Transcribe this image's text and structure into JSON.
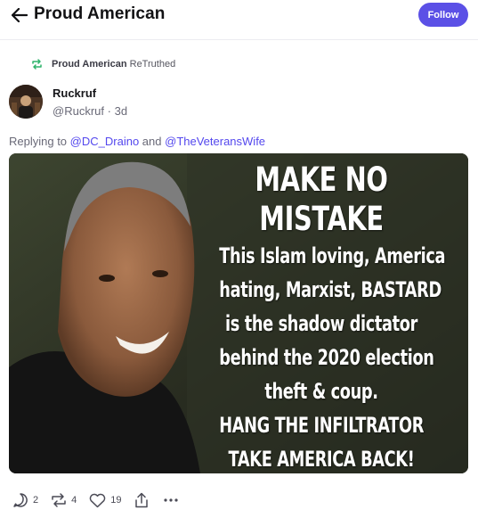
{
  "header": {
    "title": "Proud American",
    "follow_label": "Follow"
  },
  "retruth": {
    "user": "Proud American",
    "action": "ReTruthed"
  },
  "post": {
    "author_name": "Ruckruf",
    "author_handle": "@Ruckruf",
    "separator": "·",
    "age": "3d",
    "replying_prefix": "Replying to",
    "mention_1": "@DC_Draino",
    "conjunction": "and",
    "mention_2": "@TheVeteransWife",
    "image_text": {
      "line1": "MAKE NO",
      "line2": "MISTAKE",
      "line3": "This Islam loving, America",
      "line4": "hating, Marxist, BASTARD",
      "line5": "is the shadow dictator",
      "line6": "behind the 2020 election",
      "line7": "theft & coup.",
      "line8": "HANG THE INFILTRATOR",
      "line9": "TAKE AMERICA BACK!"
    }
  },
  "actions": {
    "replies": "2",
    "retruths": "4",
    "likes": "19"
  },
  "colors": {
    "accent": "#5b50e6",
    "mention": "#5448ee",
    "retruth_icon": "#2fb36b"
  }
}
